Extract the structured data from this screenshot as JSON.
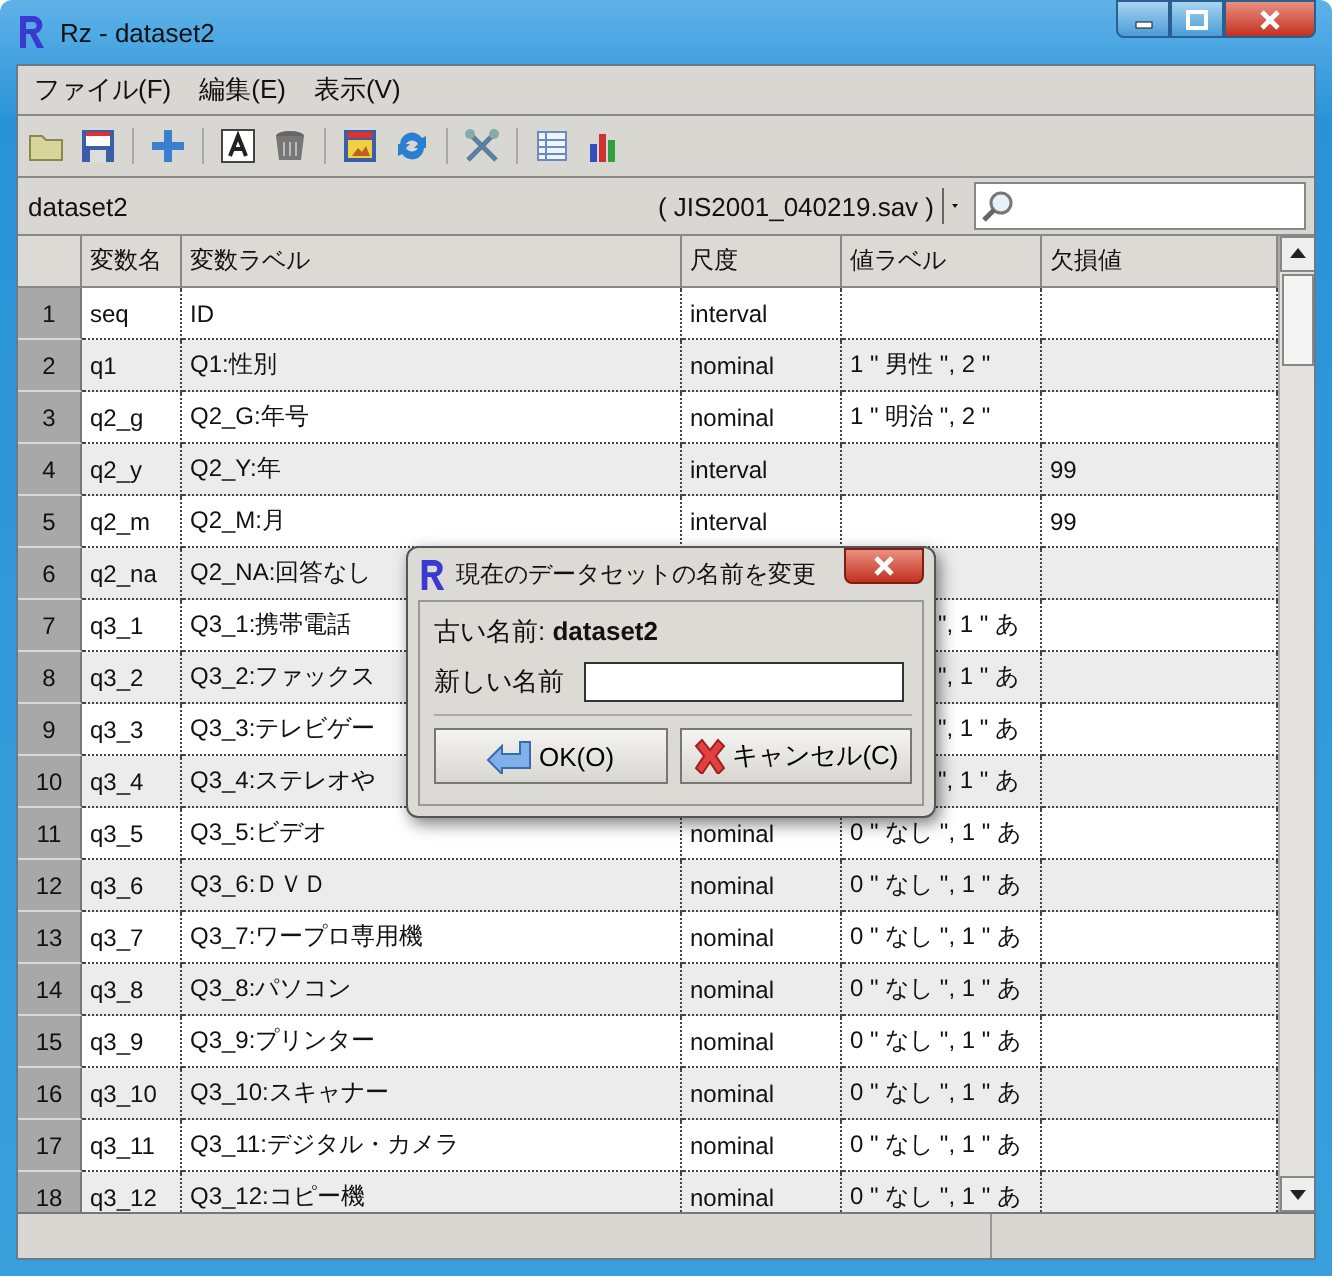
{
  "window": {
    "title": "Rz - dataset2"
  },
  "menu": [
    {
      "label": "ファイル(F)"
    },
    {
      "label": "編集(E)"
    },
    {
      "label": "表示(V)"
    }
  ],
  "dataset_selector": {
    "name": "dataset2",
    "file": "( JIS2001_040219.sav )"
  },
  "table": {
    "columns": [
      "変数名",
      "変数ラベル",
      "尺度",
      "値ラベル",
      "欠損値"
    ],
    "rows": [
      {
        "num": "1",
        "name": "seq",
        "label": "ID",
        "scale": "interval"
      },
      {
        "num": "2",
        "name": "q1",
        "label": "Q1:性別",
        "scale": "nominal",
        "value_labels": "1 \" 男性 \", 2 \""
      },
      {
        "num": "3",
        "name": "q2_g",
        "label": "Q2_G:年号",
        "scale": "nominal",
        "value_labels": "1 \" 明治 \", 2 \""
      },
      {
        "num": "4",
        "name": "q2_y",
        "label": "Q2_Y:年",
        "scale": "interval",
        "missing": "99"
      },
      {
        "num": "5",
        "name": "q2_m",
        "label": "Q2_M:月",
        "scale": "interval",
        "missing": "99"
      },
      {
        "num": "6",
        "name": "q2_na",
        "label": "Q2_NA:回答なし"
      },
      {
        "num": "7",
        "name": "q3_1",
        "label": "Q3_1:携帯電話",
        "value_labels": "\", 1 \" あ",
        "partly_hidden": true
      },
      {
        "num": "8",
        "name": "q3_2",
        "label": "Q3_2:ファックス",
        "value_labels": "\", 1 \" あ",
        "partly_hidden": true
      },
      {
        "num": "9",
        "name": "q3_3",
        "label": "Q3_3:テレビゲー",
        "value_labels": "\", 1 \" あ",
        "partly_hidden": true
      },
      {
        "num": "10",
        "name": "q3_4",
        "label": "Q3_4:ステレオや",
        "value_labels": "\", 1 \" あ",
        "partly_hidden": true
      },
      {
        "num": "11",
        "name": "q3_5",
        "label": "Q3_5:ビデオ",
        "scale": "nominal",
        "value_labels": "0 \" なし \", 1 \" あ"
      },
      {
        "num": "12",
        "name": "q3_6",
        "label": "Q3_6:ＤＶＤ",
        "scale": "nominal",
        "value_labels": "0 \" なし \", 1 \" あ"
      },
      {
        "num": "13",
        "name": "q3_7",
        "label": "Q3_7:ワープロ専用機",
        "scale": "nominal",
        "value_labels": "0 \" なし \", 1 \" あ"
      },
      {
        "num": "14",
        "name": "q3_8",
        "label": "Q3_8:パソコン",
        "scale": "nominal",
        "value_labels": "0 \" なし \", 1 \" あ"
      },
      {
        "num": "15",
        "name": "q3_9",
        "label": "Q3_9:プリンター",
        "scale": "nominal",
        "value_labels": "0 \" なし \", 1 \" あ"
      },
      {
        "num": "16",
        "name": "q3_10",
        "label": "Q3_10:スキャナー",
        "scale": "nominal",
        "value_labels": "0 \" なし \", 1 \" あ"
      },
      {
        "num": "17",
        "name": "q3_11",
        "label": "Q3_11:デジタル・カメラ",
        "scale": "nominal",
        "value_labels": "0 \" なし \", 1 \" あ"
      },
      {
        "num": "18",
        "name": "q3_12",
        "label": "Q3_12:コピー機",
        "scale": "nominal",
        "value_labels": "0 \" なし \", 1 \" あ"
      }
    ]
  },
  "dialog": {
    "title": "現在のデータセットの名前を変更",
    "old_name": "古い名前: **dataset2**",
    "new_name_label": "新しい名前",
    "ok": "OK(O)",
    "cancel": "キャンセル(C)"
  }
}
